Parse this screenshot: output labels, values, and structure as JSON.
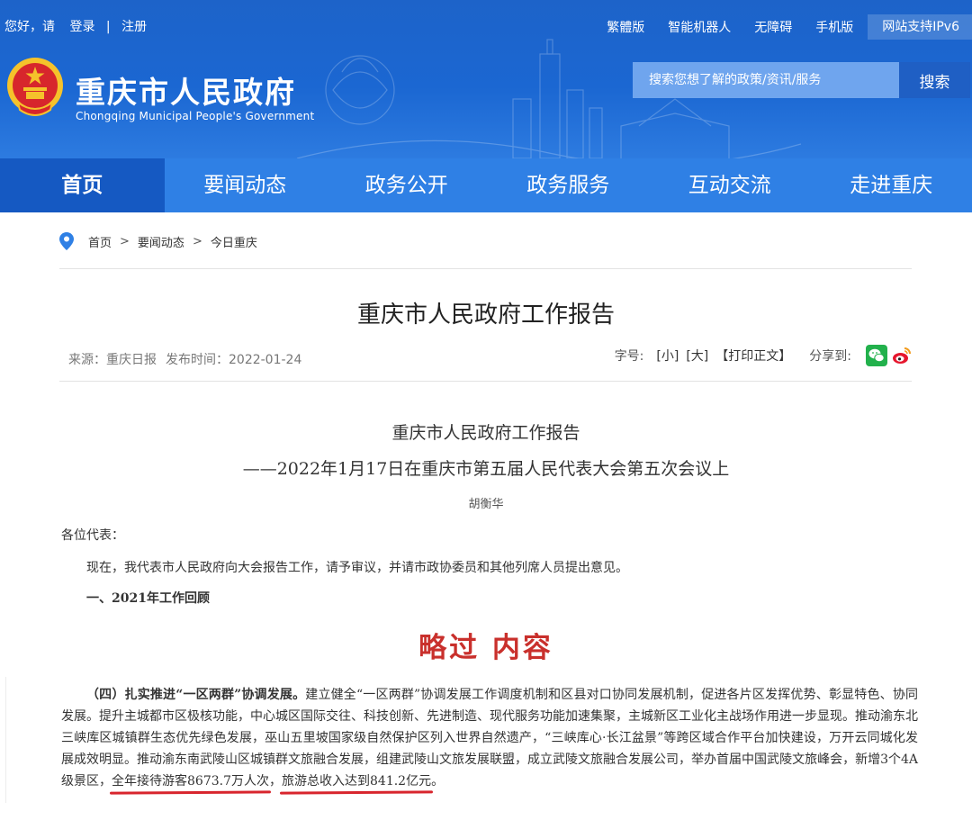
{
  "topbar": {
    "greeting": "您好，请",
    "login": "登录",
    "divider": "|",
    "register": "注册",
    "links": [
      "繁體版",
      "智能机器人",
      "无障碍",
      "手机版"
    ],
    "ipv6": "网站支持IPv6"
  },
  "site": {
    "title": "重庆市人民政府",
    "title_en": "Chongqing Municipal People's Government",
    "emblem_icon": "national-emblem-icon"
  },
  "search": {
    "placeholder": "搜索您想了解的政策/资讯/服务",
    "button": "搜索"
  },
  "nav": {
    "items": [
      {
        "label": "首页",
        "active": true
      },
      {
        "label": "要闻动态",
        "active": false
      },
      {
        "label": "政务公开",
        "active": false
      },
      {
        "label": "政务服务",
        "active": false
      },
      {
        "label": "互动交流",
        "active": false
      },
      {
        "label": "走进重庆",
        "active": false
      }
    ]
  },
  "breadcrumb": {
    "items": [
      "首页",
      "要闻动态",
      "今日重庆"
    ],
    "separator": ">"
  },
  "article": {
    "title": "重庆市人民政府工作报告",
    "source": "来源：重庆日报",
    "published": "发布时间：2022-01-24",
    "font_size_label": "字号:",
    "font_small": "[小]",
    "font_large": "[大]",
    "print": "【打印正文】",
    "share_label": "分享到:"
  },
  "content": {
    "title": "重庆市人民政府工作报告",
    "subtitle": "——2022年1月17日在重庆市第五届人民代表大会第五次会议上",
    "author": "胡衡华",
    "greeting": "各位代表：",
    "para1": "现在，我代表市人民政府向大会报告工作，请予审议，并请市政协委员和其他列席人员提出意见。",
    "section1": "一、2021年工作回顾",
    "skip_note": "略过 内容",
    "excerpt_lead": "（四）扎实推进“一区两群”协调发展。",
    "excerpt_body": "建立健全“一区两群”协调发展工作调度机制和区县对口协同发展机制，促进各片区发挥优势、彰显特色、协同发展。提升主城都市区极核功能，中心城区国际交往、科技创新、先进制造、现代服务功能加速集聚，主城新区工业化主战场作用进一步显现。推动渝东北三峡库区城镇群生态优先绿色发展，巫山五里坡国家级自然保护区列入世界自然遗产，“三峡库心·长江盆景”等跨区域合作平台加快建设，万开云同城化发展成效明显。推动渝东南武陵山区城镇群文旅融合发展，组建武陵山文旅发展联盟，成立武陵文旅融合发展公司，举办首届中国武陵文旅峰会，新增3个4A级景区，",
    "highlight1": "全年接待游客8673.7万人次",
    "comma": "，",
    "highlight2": "旅游总收入达到841.2亿元",
    "period": "。"
  },
  "colors": {
    "header_blue": "#1b67d2",
    "nav_blue": "#2f80e5",
    "nav_active": "#1559c2",
    "skip_red": "#c9302c",
    "underline_red": "#d8252d"
  }
}
